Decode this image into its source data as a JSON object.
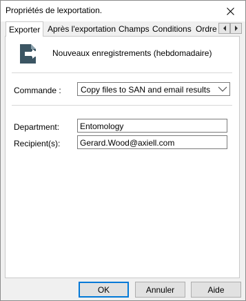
{
  "window": {
    "title": "Propriétés de lexportation."
  },
  "tabs": [
    {
      "label": "Exporter"
    },
    {
      "label": "Après l'exportation"
    },
    {
      "label": "Champs"
    },
    {
      "label": "Conditions"
    },
    {
      "label": "Ordre d"
    }
  ],
  "tab_scroll": {
    "left_icon": "arrow-left-icon",
    "right_icon": "arrow-right-icon"
  },
  "export": {
    "icon": "export-icon",
    "icon_color": "#3b5563",
    "name": "Nouveaux enregistrements (hebdomadaire)"
  },
  "command": {
    "label": "Commande :",
    "value": "Copy files to SAN and email results"
  },
  "params": [
    {
      "label": "Department:",
      "value": "Entomology"
    },
    {
      "label": "Recipient(s):",
      "value": "Gerard.Wood@axiell.com"
    }
  ],
  "buttons": {
    "ok": "OK",
    "cancel": "Annuler",
    "help": "Aide"
  },
  "colors": {
    "accent": "#0078d7"
  }
}
